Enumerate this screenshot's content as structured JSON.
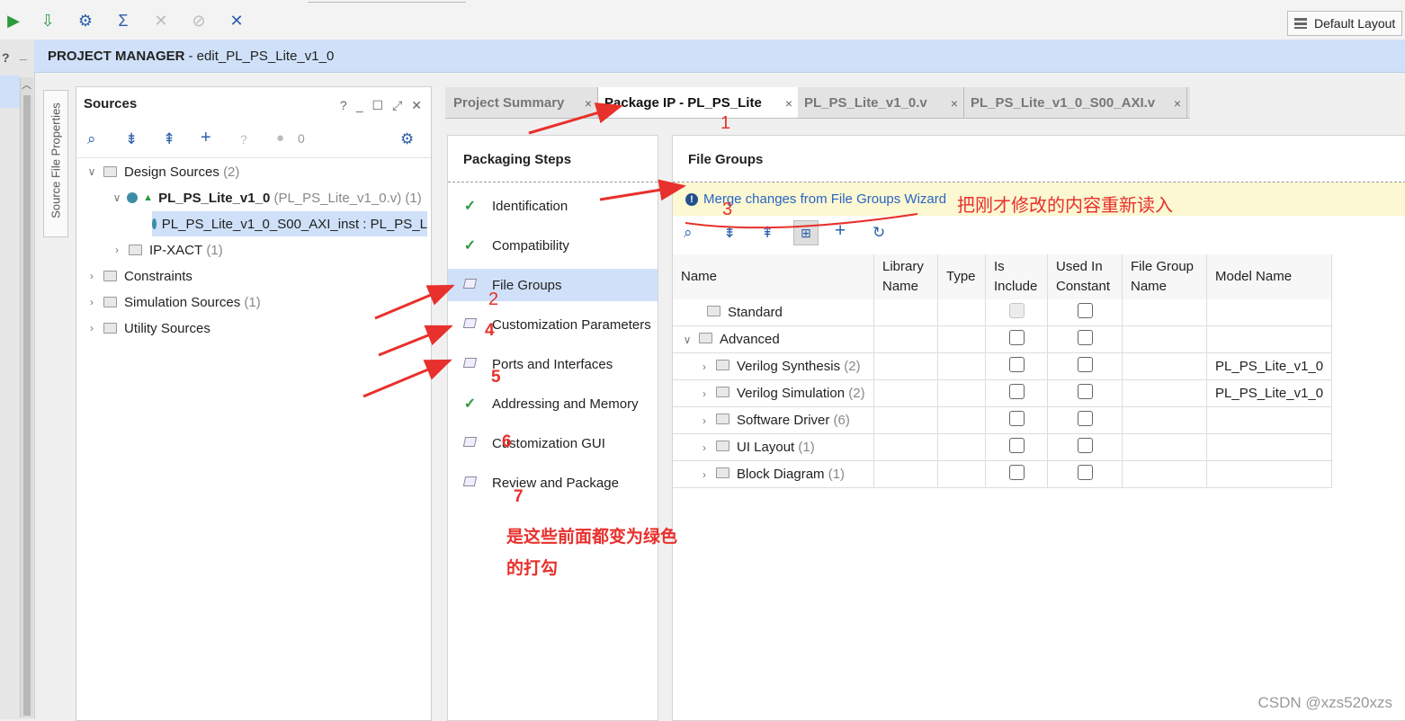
{
  "toolbar": {
    "layout_label": "Default Layout",
    "icons": [
      "run-icon",
      "download-icon",
      "settings-icon",
      "sigma-icon",
      "disabled-tool-icon",
      "disabled-tool-icon",
      "disconnect-icon"
    ]
  },
  "header": {
    "section": "PROJECT MANAGER",
    "project": "- edit_PL_PS_Lite_v1_0"
  },
  "left_strip": {
    "help": "?",
    "minimize": "_"
  },
  "side_tab": {
    "label": "Source File Properties"
  },
  "sources": {
    "title": "Sources",
    "controls": [
      "?",
      "_",
      "☐",
      "⤢",
      "✕"
    ],
    "count": "0",
    "tree": {
      "design": {
        "label": "Design Sources",
        "count": "(2)"
      },
      "top": {
        "label": "PL_PS_Lite_v1_0",
        "detail": "(PL_PS_Lite_v1_0.v) (1)"
      },
      "inst": {
        "label": "PL_PS_Lite_v1_0_S00_AXI_inst : PL_PS_L"
      },
      "ipxact": {
        "label": "IP-XACT",
        "count": "(1)"
      },
      "constraints": {
        "label": "Constraints"
      },
      "simulation": {
        "label": "Simulation Sources",
        "count": "(1)"
      },
      "utility": {
        "label": "Utility Sources"
      }
    }
  },
  "tabs": [
    {
      "label": "Project Summary"
    },
    {
      "label": "Package IP - PL_PS_Lite"
    },
    {
      "label": "PL_PS_Lite_v1_0.v"
    },
    {
      "label": "PL_PS_Lite_v1_0_S00_AXI.v"
    }
  ],
  "steps": {
    "title": "Packaging Steps",
    "items": [
      {
        "label": "Identification"
      },
      {
        "label": "Compatibility"
      },
      {
        "label": "File Groups"
      },
      {
        "label": "Customization Parameters"
      },
      {
        "label": "Ports and Interfaces"
      },
      {
        "label": "Addressing and Memory"
      },
      {
        "label": "Customization GUI"
      },
      {
        "label": "Review and Package"
      }
    ]
  },
  "file_groups": {
    "title": "File Groups",
    "merge_link": "Merge changes from File Groups Wizard",
    "columns": [
      "Name",
      "Library Name",
      "Type",
      "Is Include",
      "Used In Constant",
      "File Group Name",
      "Model Name"
    ],
    "rows": [
      {
        "name": "Standard",
        "count": "",
        "model": ""
      },
      {
        "name": "Advanced",
        "count": "",
        "model": ""
      },
      {
        "name": "Verilog Synthesis",
        "count": "(2)",
        "model": "PL_PS_Lite_v1_0"
      },
      {
        "name": "Verilog Simulation",
        "count": "(2)",
        "model": "PL_PS_Lite_v1_0"
      },
      {
        "name": "Software Driver",
        "count": "(6)",
        "model": ""
      },
      {
        "name": "UI Layout",
        "count": "(1)",
        "model": ""
      },
      {
        "name": "Block Diagram",
        "count": "(1)",
        "model": ""
      }
    ]
  },
  "annotations": {
    "n1": "1",
    "n2": "2",
    "n3": "3",
    "n4": "4",
    "n5": "5",
    "n6": "6",
    "n7": "7",
    "reload_note": "把刚才修改的内容重新读入",
    "green_note_1": "是这些前面都变为绿色",
    "green_note_2": "的打勾"
  },
  "watermark": "CSDN @xzs520xzs",
  "colors": {
    "accent": "#2c5fa8",
    "header_bg": "#cfe0f8",
    "annotation": "#e8302c",
    "check": "#2e9a3c",
    "banner": "#fbf8d2"
  }
}
